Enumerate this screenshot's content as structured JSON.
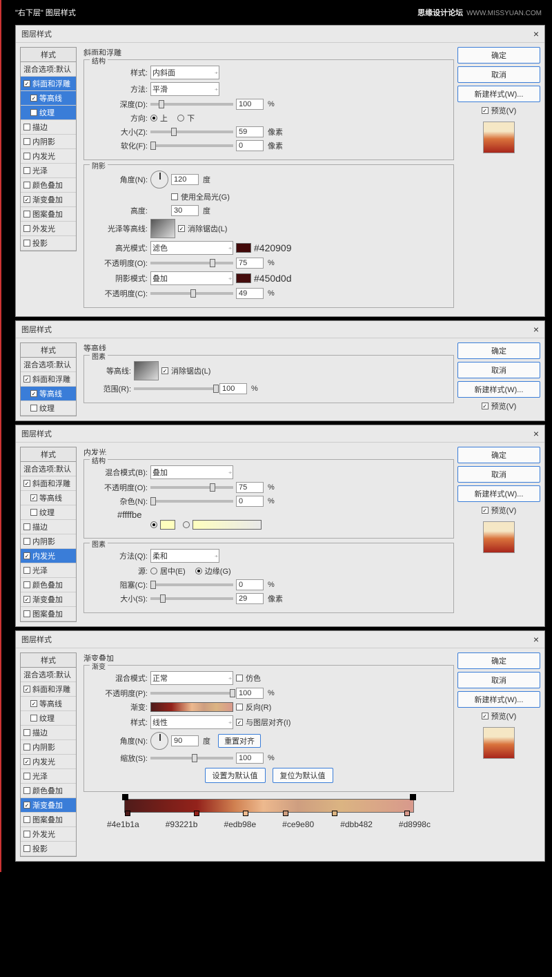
{
  "header": "\"右下层\" 图层样式",
  "watermark": {
    "bold": "思缘设计论坛",
    "url": "WWW.MISSYUAN.COM"
  },
  "common": {
    "dialog_title": "图层样式",
    "ok": "确定",
    "cancel": "取消",
    "new_style": "新建样式(W)...",
    "preview": "预览(V)",
    "styles_header": "样式",
    "blend_default": "混合选项:默认",
    "style_items": [
      {
        "label": "斜面和浮雕",
        "chk": true,
        "indent": false
      },
      {
        "label": "等高线",
        "chk": true,
        "indent": true
      },
      {
        "label": "纹理",
        "chk": false,
        "indent": true
      },
      {
        "label": "描边",
        "chk": false,
        "indent": false
      },
      {
        "label": "内阴影",
        "chk": false,
        "indent": false
      },
      {
        "label": "内发光",
        "chk": false,
        "indent": false
      },
      {
        "label": "光泽",
        "chk": false,
        "indent": false
      },
      {
        "label": "颜色叠加",
        "chk": false,
        "indent": false
      },
      {
        "label": "渐变叠加",
        "chk": true,
        "indent": false
      },
      {
        "label": "图案叠加",
        "chk": false,
        "indent": false
      },
      {
        "label": "外发光",
        "chk": false,
        "indent": false
      },
      {
        "label": "投影",
        "chk": false,
        "indent": false
      }
    ]
  },
  "panel1": {
    "section": "斜面和浮雕",
    "struct": "结构",
    "style_lbl": "样式:",
    "style_val": "内斜面",
    "method_lbl": "方法:",
    "method_val": "平滑",
    "depth_lbl": "深度(D):",
    "depth_val": "100",
    "pct": "%",
    "dir_lbl": "方向:",
    "up": "上",
    "down": "下",
    "size_lbl": "大小(Z):",
    "size_val": "59",
    "px": "像素",
    "soften_lbl": "软化(F):",
    "soften_val": "0",
    "shade": "阴影",
    "angle_lbl": "角度(N):",
    "angle_val": "120",
    "deg": "度",
    "global": "使用全局光(G)",
    "alt_lbl": "高度:",
    "alt_val": "30",
    "gloss_lbl": "光泽等高线:",
    "aa": "消除锯齿(L)",
    "hl_mode_lbl": "高光模式:",
    "hl_mode_val": "滤色",
    "hl_hex": "#420909",
    "hl_op_lbl": "不透明度(O):",
    "hl_op_val": "75",
    "sh_mode_lbl": "阴影模式:",
    "sh_mode_val": "叠加",
    "sh_hex": "#450d0d",
    "sh_op_lbl": "不透明度(C):",
    "sh_op_val": "49"
  },
  "panel2": {
    "section": "等高线",
    "sub": "图素",
    "contour_lbl": "等高线:",
    "aa": "消除锯齿(L)",
    "range_lbl": "范围(R):",
    "range_val": "100",
    "pct": "%"
  },
  "panel3": {
    "section": "内发光",
    "struct": "结构",
    "blend_lbl": "混合模式(B):",
    "blend_val": "叠加",
    "op_lbl": "不透明度(O):",
    "op_val": "75",
    "pct": "%",
    "noise_lbl": "杂色(N):",
    "noise_val": "0",
    "color_hex": "#ffffbe",
    "sub": "图素",
    "method_lbl": "方法(Q):",
    "method_val": "柔和",
    "source_lbl": "源:",
    "center": "居中(E)",
    "edge": "边缘(G)",
    "choke_lbl": "阻塞(C):",
    "choke_val": "0",
    "size_lbl": "大小(S):",
    "size_val": "29",
    "px": "像素"
  },
  "panel4": {
    "section": "渐变叠加",
    "sub": "渐变",
    "blend_lbl": "混合模式:",
    "blend_val": "正常",
    "dither": "仿色",
    "op_lbl": "不透明度(P):",
    "op_val": "100",
    "pct": "%",
    "grad_lbl": "渐变:",
    "reverse": "反向(R)",
    "style_lbl": "样式:",
    "style_val": "线性",
    "align": "与图层对齐(I)",
    "angle_lbl": "角度(N):",
    "angle_val": "90",
    "deg": "度",
    "reset": "重置对齐",
    "scale_lbl": "缩放(S):",
    "scale_val": "100",
    "set_default": "设置为默认值",
    "reset_default": "复位为默认值",
    "hex1": "#4e1b1a",
    "hex2": "#93221b",
    "hex3": "#edb98e",
    "hex4": "#ce9e80",
    "hex5": "#dbb482",
    "hex6": "#d8998c"
  }
}
